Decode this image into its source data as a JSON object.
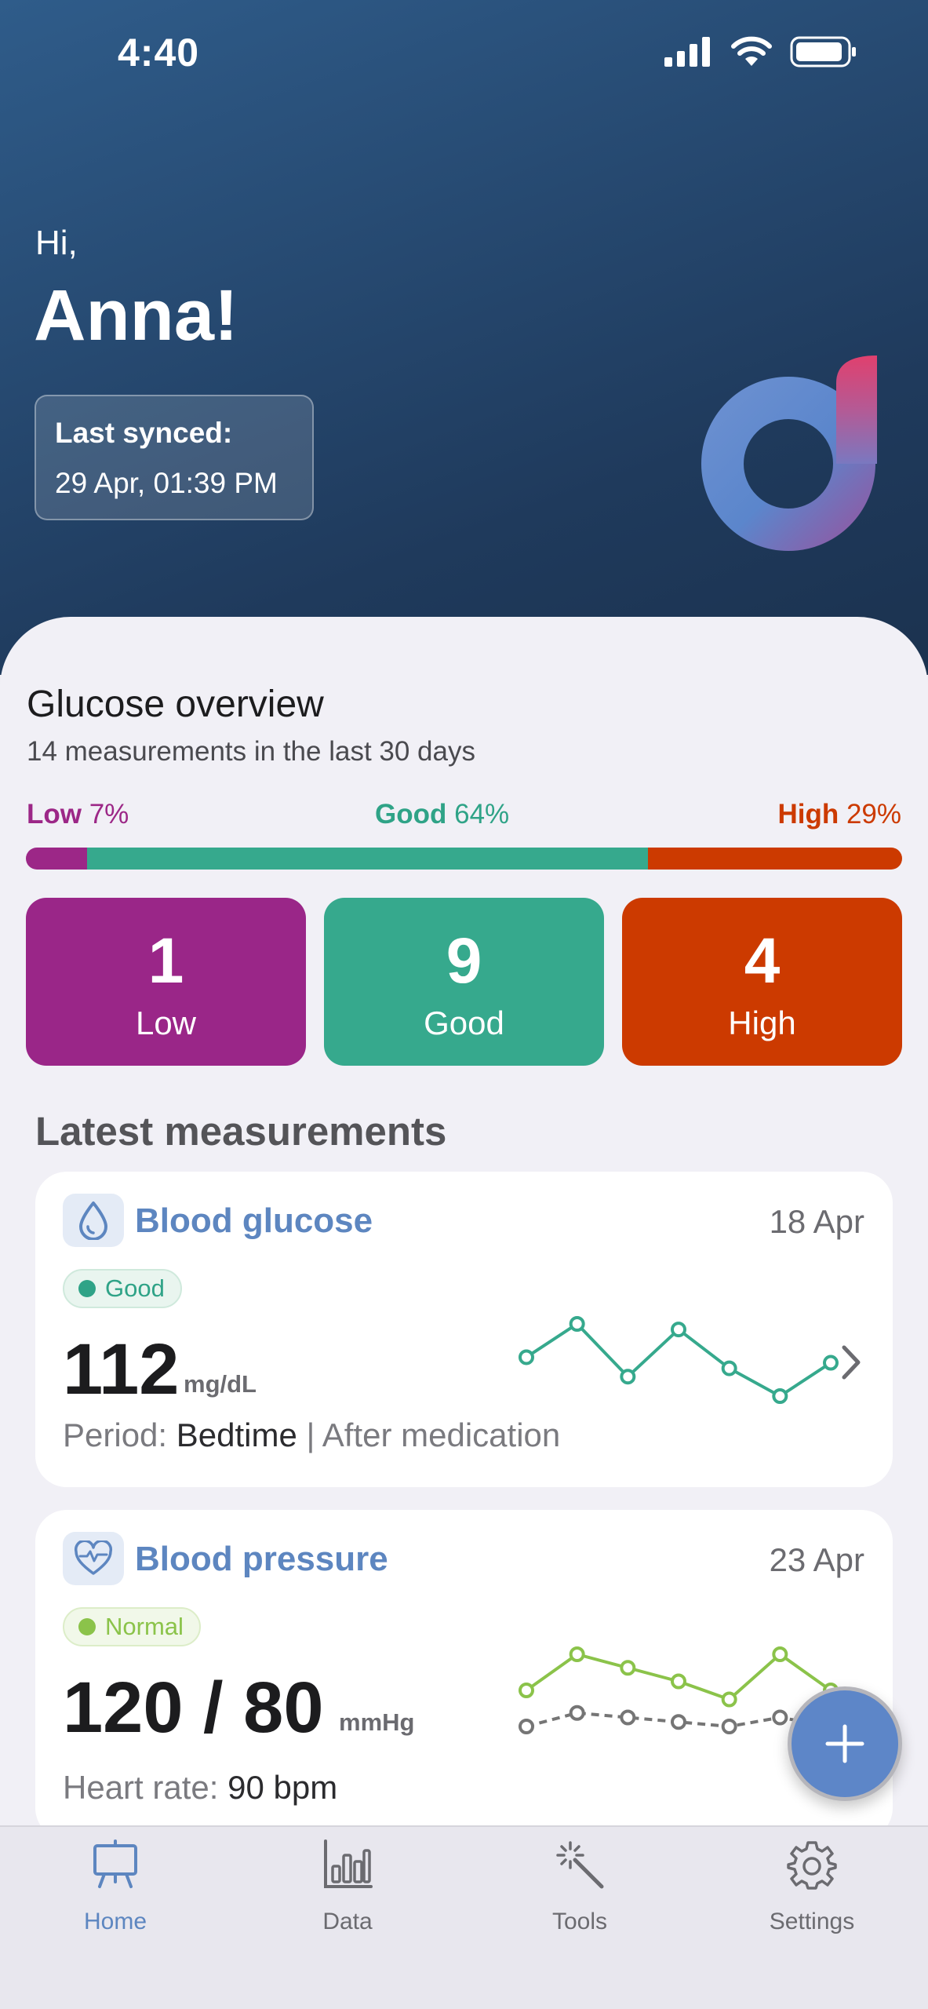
{
  "status": {
    "time": "4:40"
  },
  "greeting": {
    "hi": "Hi,",
    "name": "Anna!"
  },
  "sync": {
    "label": "Last synced:",
    "value": "29 Apr, 01:39 PM"
  },
  "overview": {
    "title": "Glucose overview",
    "subtitle": "14 measurements in the last 30 days",
    "distribution": [
      {
        "label": "Low",
        "percent": "7%",
        "fraction": 0.07,
        "color": "#9c2787"
      },
      {
        "label": "Good",
        "percent": "64%",
        "fraction": 0.64,
        "color": "#36a98d"
      },
      {
        "label": "High",
        "percent": "29%",
        "fraction": 0.29,
        "color": "#cc3a00"
      }
    ],
    "counts": [
      {
        "value": "1",
        "label": "Low",
        "color": "#9a2688"
      },
      {
        "value": "9",
        "label": "Good",
        "color": "#36a98d"
      },
      {
        "value": "4",
        "label": "High",
        "color": "#cc3a00"
      }
    ]
  },
  "latest": {
    "title": "Latest measurements",
    "glucose": {
      "icon": "drop-icon",
      "title": "Blood glucose",
      "date": "18 Apr",
      "status": "Good",
      "status_color": "#2fa387",
      "value": "112",
      "unit": "mg/dL",
      "period_label": "Period:",
      "period_value": "Bedtime",
      "period_extra": "| After medication",
      "trend": [
        112,
        124,
        105,
        122,
        108,
        98,
        110
      ]
    },
    "pressure": {
      "icon": "heart-pulse-icon",
      "title": "Blood pressure",
      "date": "23 Apr",
      "status": "Normal",
      "status_color": "#8bc34a",
      "value": "120 / 80",
      "unit": "mmHg",
      "hr_label": "Heart rate:",
      "hr_value": "90 bpm",
      "trend_systolic": [
        120,
        128,
        125,
        122,
        118,
        128,
        120
      ],
      "trend_diastolic": [
        112,
        115,
        114,
        113,
        112,
        114,
        112
      ]
    }
  },
  "fab": {
    "icon": "plus-icon"
  },
  "tabs": [
    {
      "label": "Home",
      "icon": "easel-icon",
      "active": true
    },
    {
      "label": "Data",
      "icon": "bar-chart-icon",
      "active": false
    },
    {
      "label": "Tools",
      "icon": "magic-wand-icon",
      "active": false
    },
    {
      "label": "Settings",
      "icon": "gear-icon",
      "active": false
    }
  ]
}
